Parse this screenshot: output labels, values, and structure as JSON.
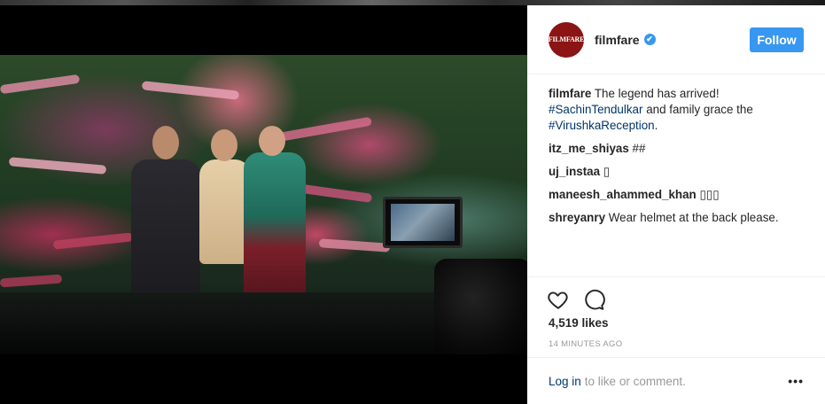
{
  "post": {
    "author": {
      "username": "filmfare",
      "avatar_text": "FILMFARE",
      "verified_glyph": "✔",
      "follow_label": "Follow"
    },
    "caption": {
      "username": "filmfare",
      "text_before": "The legend has arrived!",
      "hashtag_1": "#SachinTendulkar",
      "text_middle": "and family grace the",
      "hashtag_2": "#VirushkaReception",
      "text_after": "."
    },
    "comments": [
      {
        "username": "itz_me_shiyas",
        "text": "##"
      },
      {
        "username": "uj_instaa",
        "text": "▯"
      },
      {
        "username": "maneesh_ahammed_khan",
        "text": "▯▯▯"
      },
      {
        "username": "shreyanry",
        "text": "Wear helmet at the back please."
      }
    ],
    "likes": "4,519 likes",
    "timestamp": "14 MINUTES AGO",
    "footer": {
      "login_label": "Log in",
      "login_suffix": "to like or comment.",
      "more_label": "•••"
    },
    "icons": {
      "like": "heart-icon",
      "comment": "comment-icon"
    }
  },
  "colors": {
    "accent": "#3897f0",
    "link": "#003569",
    "avatar_bg": "#8b1414"
  }
}
